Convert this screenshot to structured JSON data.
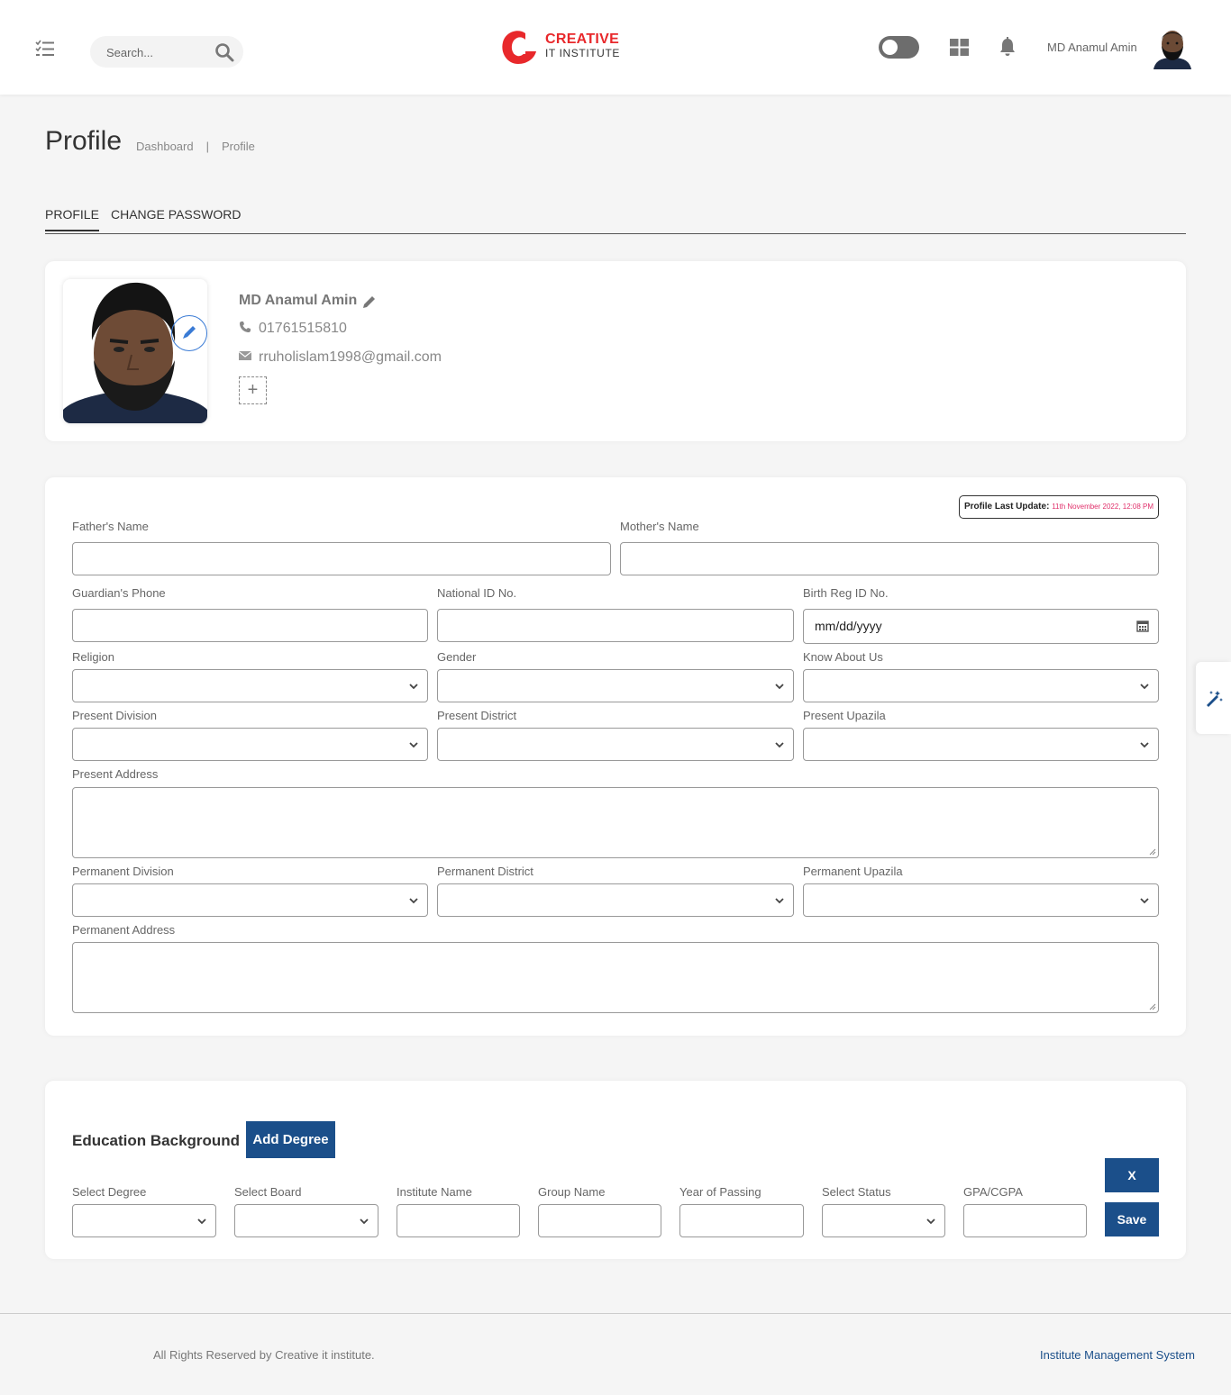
{
  "header": {
    "search_placeholder": "Search...",
    "logo_line1": "CREATIVE",
    "logo_line2": "IT INSTITUTE",
    "user_name": "MD Anamul Amin"
  },
  "page": {
    "title": "Profile",
    "breadcrumb": [
      "Dashboard",
      "|",
      "Profile"
    ]
  },
  "tabs": [
    {
      "label": "PROFILE",
      "active": true
    },
    {
      "label": "CHANGE PASSWORD",
      "active": false
    }
  ],
  "profile": {
    "name": "MD Anamul Amin",
    "phone": "01761515810",
    "email": "rruholislam1998@gmail.com",
    "add_label": "+"
  },
  "form": {
    "last_update_label": "Profile Last Update:",
    "last_update_value": "11th November 2022, 12:08 PM",
    "fathers_name": {
      "label": "Father's Name",
      "value": ""
    },
    "mothers_name": {
      "label": "Mother's Name",
      "value": ""
    },
    "guardian_phone": {
      "label": "Guardian's Phone",
      "value": ""
    },
    "national_id": {
      "label": "National ID No.",
      "value": ""
    },
    "birth_reg": {
      "label": "Birth Reg ID No.",
      "value": "mm/dd/yyyy"
    },
    "religion": {
      "label": "Religion",
      "value": ""
    },
    "gender": {
      "label": "Gender",
      "value": ""
    },
    "know_about": {
      "label": "Know About Us",
      "value": ""
    },
    "present_division": {
      "label": "Present Division",
      "value": ""
    },
    "present_district": {
      "label": "Present District",
      "value": ""
    },
    "present_upazila": {
      "label": "Present Upazila",
      "value": ""
    },
    "present_address": {
      "label": "Present Address",
      "value": ""
    },
    "permanent_division": {
      "label": "Permanent Division",
      "value": ""
    },
    "permanent_district": {
      "label": "Permanent District",
      "value": ""
    },
    "permanent_upazila": {
      "label": "Permanent Upazila",
      "value": ""
    },
    "permanent_address": {
      "label": "Permanent Address",
      "value": ""
    }
  },
  "education": {
    "title": "Education Background",
    "add_degree": "Add Degree",
    "select_degree": "Select Degree",
    "select_board": "Select Board",
    "institute_name": "Institute Name",
    "group_name": "Group Name",
    "year_of_passing": "Year of Passing",
    "select_status": "Select Status",
    "gpa": "GPA/CGPA",
    "remove_label": "X",
    "save_label": "Save"
  },
  "footer": {
    "copyright": "All Rights Reserved by Creative it institute.",
    "system_name": "Institute Management System"
  },
  "colors": {
    "brand_red": "#e8282b",
    "primary_blue": "#1b4f8a",
    "update_pink": "#e0306b"
  },
  "icons": [
    "menu-icon",
    "search-icon",
    "toggle-switch",
    "grid-icon",
    "bell-icon",
    "pencil-icon",
    "phone-icon",
    "envelope-icon",
    "plus-icon",
    "chevron-down-icon",
    "calendar-icon",
    "magic-wand-icon"
  ]
}
